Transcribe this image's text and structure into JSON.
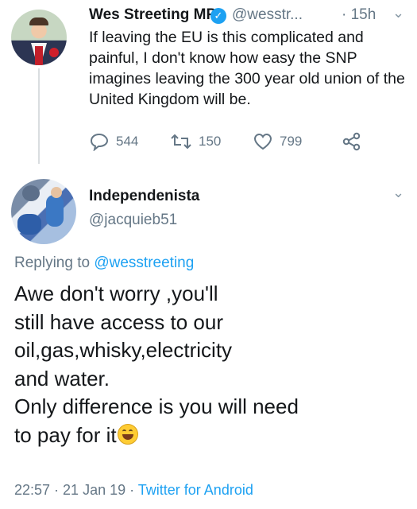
{
  "tweet1": {
    "author_name": "Wes Streeting MP",
    "verified_mark": "✓",
    "handle": "@wesstr...",
    "time": "· 15h",
    "text": "If leaving the EU is this complicated and painful, I don't know how easy the SNP imagines leaving the 300 year old union of the United Kingdom will be.",
    "replies": "544",
    "retweets": "150",
    "likes": "799"
  },
  "tweet2": {
    "author_name": "Independenista",
    "handle": "@jacquieb51",
    "replying_prefix": "Replying to ",
    "replying_to": "@wesstreeting",
    "text_lines": [
      "Awe don't worry ,you'll",
      "still have access to our",
      "oil,gas,whisky,electricity",
      "and water.",
      "Only difference is you will need",
      "to pay for it"
    ],
    "timestamp": "22:57 · 21 Jan 19 · ",
    "source": "Twitter for Android"
  },
  "icons": {
    "caret": "⌄",
    "emoji": "grinning-sweat-emoji"
  },
  "colors": {
    "accent": "#1da1f2",
    "muted": "#657786",
    "text": "#14171a"
  }
}
